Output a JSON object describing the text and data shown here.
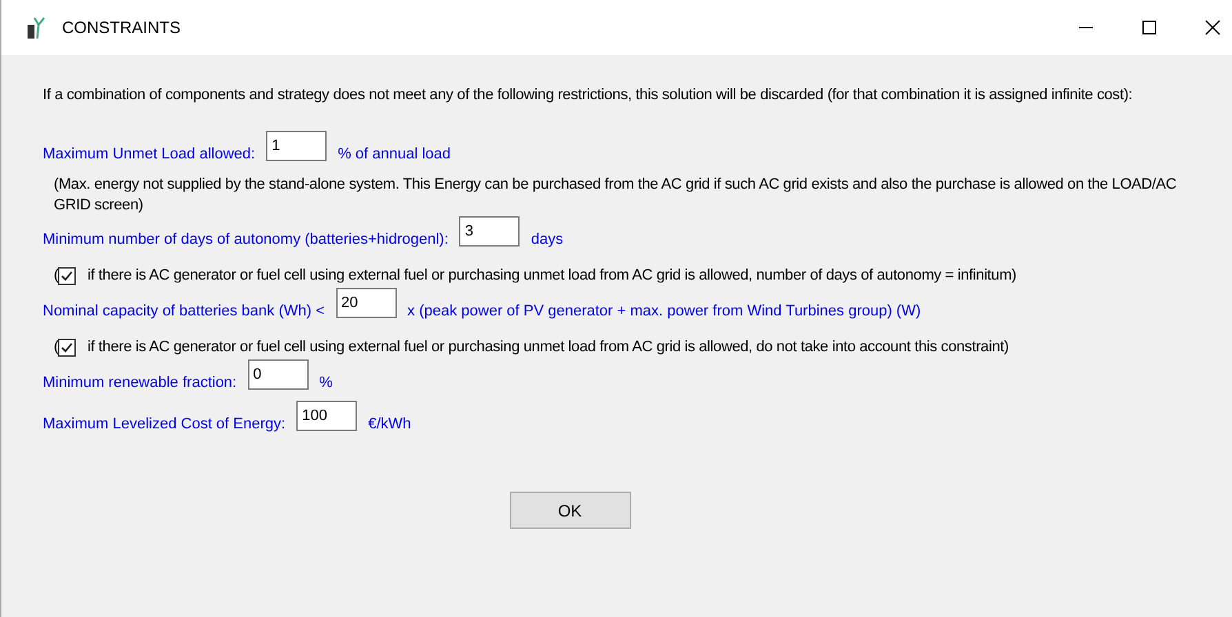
{
  "window": {
    "title": "CONSTRAINTS"
  },
  "intro": "If a combination of components and strategy does not meet any of the following restrictions, this solution will be discarded (for that combination it is assigned infinite cost):",
  "rows": [
    {
      "kind": "field",
      "label": "Maximum Unmet Load allowed:",
      "value": "1",
      "unit": "% of annual load"
    },
    {
      "kind": "note",
      "text": "(Max. energy not supplied by the stand-alone system. This Energy can be purchased from the AC grid if such AC grid exists and also the purchase is allowed on the LOAD/AC GRID screen)"
    },
    {
      "kind": "field",
      "label": "Minimum number of days of autonomy  (batteries+hidrogenl):",
      "value": "3",
      "unit": "days"
    },
    {
      "kind": "check",
      "prefix": "(",
      "checked": true,
      "text": "if there is AC generator or fuel cell using external fuel or purchasing unmet load from AC grid is allowed, number of days of autonomy =  infinitum)"
    },
    {
      "kind": "field",
      "label": "Nominal capacity of batteries bank (Wh) <",
      "value": "20",
      "unit": "x (peak power of PV generator  + max. power from Wind Turbines group) (W)"
    },
    {
      "kind": "check",
      "prefix": "(",
      "checked": true,
      "text": "if there is AC generator or fuel cell using external fuel or purchasing unmet load from AC grid is allowed, do not take into account this constraint)"
    },
    {
      "kind": "field",
      "label": "Minimum renewable fraction:",
      "value": "0",
      "unit": "%"
    },
    {
      "kind": "field",
      "label": "Maximum Levelized Cost of Energy:",
      "value": "100",
      "unit": "€/kWh"
    }
  ],
  "buttons": [
    "OK"
  ]
}
